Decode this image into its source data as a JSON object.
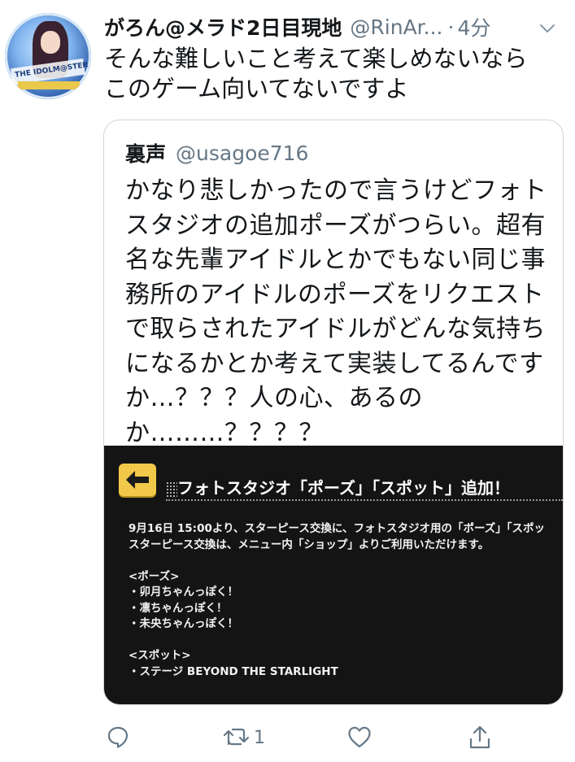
{
  "tweet": {
    "author_name": "がろん@メラド2日目現地",
    "author_handle": "@RinAr...",
    "separator": "·",
    "time": "4分",
    "text": "そんな難しいこと考えて楽しめないなら\nこのゲーム向いてないですよ",
    "avatar_text": "THE IDOLM@STER"
  },
  "quote": {
    "author_name": "裏声",
    "author_handle": "@usagoe716",
    "text": "かなり悲しかったので言うけどフォト\nスタジオの追加ポーズがつらい。超有\n名な先輩アイドルとかでもない同じ事\n務所のアイドルのポーズをリクエスト\nで取らされたアイドルがどんな気持ち\nになるかとか考えて実装してるんです\nか…？？？人の心、あるの\nか………？？？？",
    "image": {
      "title": "フォトスタジオ「ポーズ」「スポット」追加！",
      "body": "9月16日 15:00より、スターピース交換に、フォトスタジオ用の「ポーズ」「スポッ\nスターピース交換は、メニュー内「ショップ」よりご利用いただけます。\n\n<ポーズ>\n・卯月ちゃんっぽく！\n・凛ちゃんっぽく！\n・未央ちゃんっぽく！\n\n<スポット>\n・ステージ BEYOND THE STARLIGHT"
    }
  },
  "actions": {
    "retweet_count": "1",
    "icons": [
      "reply-icon",
      "retweet-icon",
      "like-icon",
      "share-icon"
    ]
  },
  "colors": {
    "text": "#14171a",
    "secondary": "#657786",
    "border": "#ccd6dd",
    "image_bg": "#141414",
    "back_button": "#f2c84b"
  }
}
